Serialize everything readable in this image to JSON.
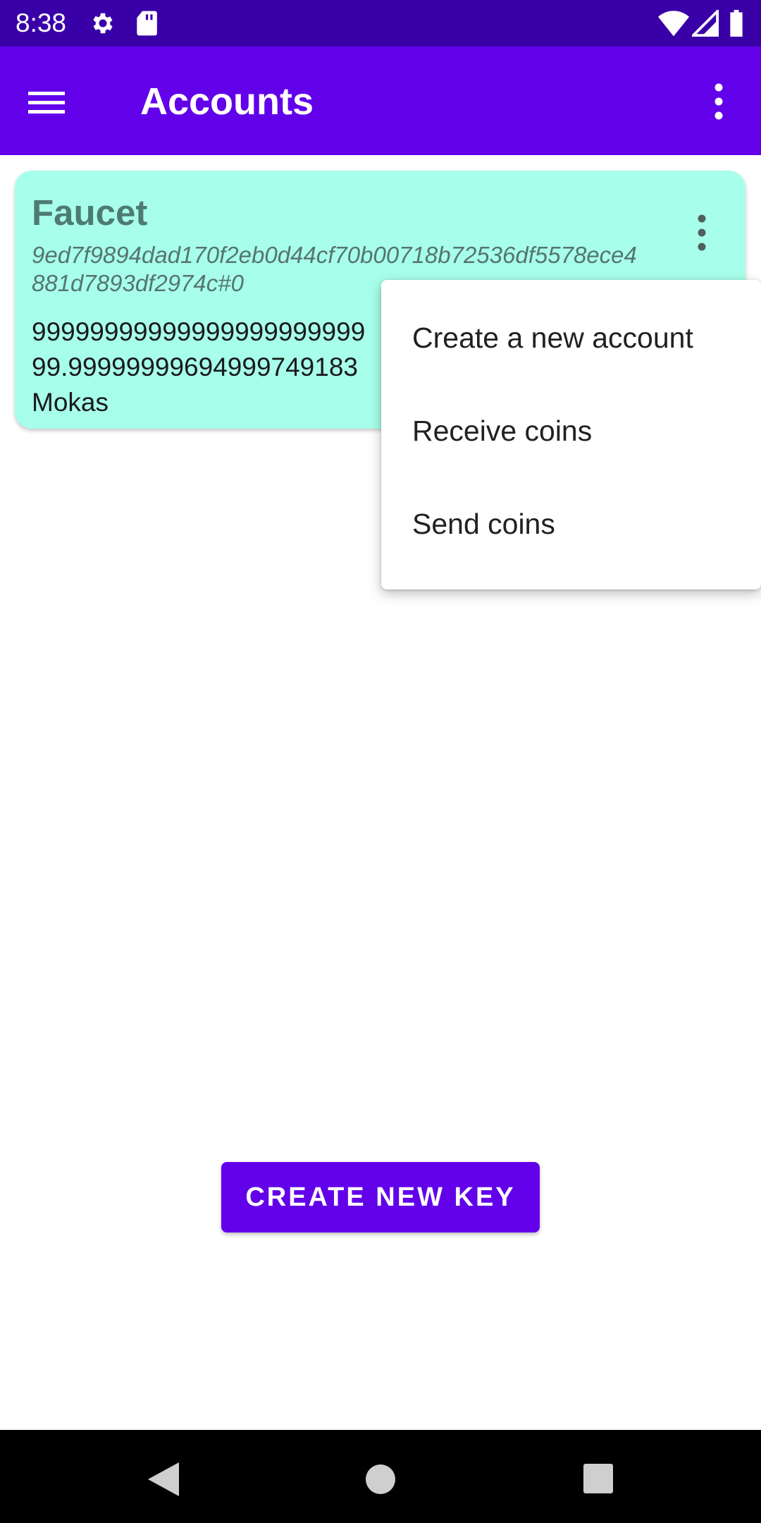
{
  "status_bar": {
    "time": "8:38",
    "icons": [
      "gear-icon",
      "sd-card-icon",
      "wifi-icon",
      "signal-icon",
      "battery-icon"
    ]
  },
  "app_bar": {
    "title": "Accounts",
    "icons": [
      "hamburger-menu-icon",
      "overflow-menu-icon"
    ]
  },
  "account_card": {
    "name": "Faucet",
    "address": "9ed7f9894dad170f2eb0d44cf70b00718b72536df5578ece4881d7893df2974c#0",
    "balance_line1": "99999999999999999999999",
    "balance_line2": "99.99999999694999749183",
    "currency": "Mokas"
  },
  "popup_menu": {
    "items": [
      "Create a new account",
      "Receive coins",
      "Send coins"
    ]
  },
  "create_key_button": {
    "label": "CREATE NEW KEY"
  },
  "colors": {
    "status_bar": "#3a00a8",
    "app_bar": "#6200ea",
    "card": "#a7ffeb",
    "button": "#6200ea"
  }
}
